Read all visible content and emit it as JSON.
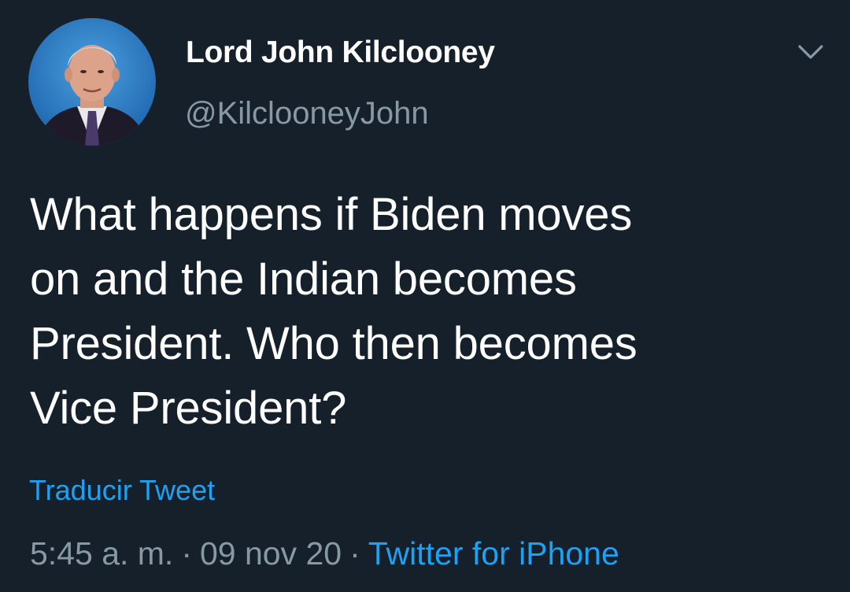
{
  "tweet": {
    "author": {
      "display_name": "Lord John Kilclooney",
      "handle": "@KilclooneyJohn",
      "avatar_icon": "profile-photo"
    },
    "text": "What happens if Biden moves\non and the Indian becomes\nPresident. Who then becomes\nVice President?",
    "translate_label": "Traducir Tweet",
    "time": "5:45 a. m.",
    "date": "09 nov 20",
    "separator": "·",
    "source": "Twitter for iPhone",
    "menu_icon": "chevron-down-icon"
  },
  "colors": {
    "background": "#15202b",
    "primary_text": "#ffffff",
    "secondary_text": "#8899a6",
    "accent": "#1da1f2"
  }
}
